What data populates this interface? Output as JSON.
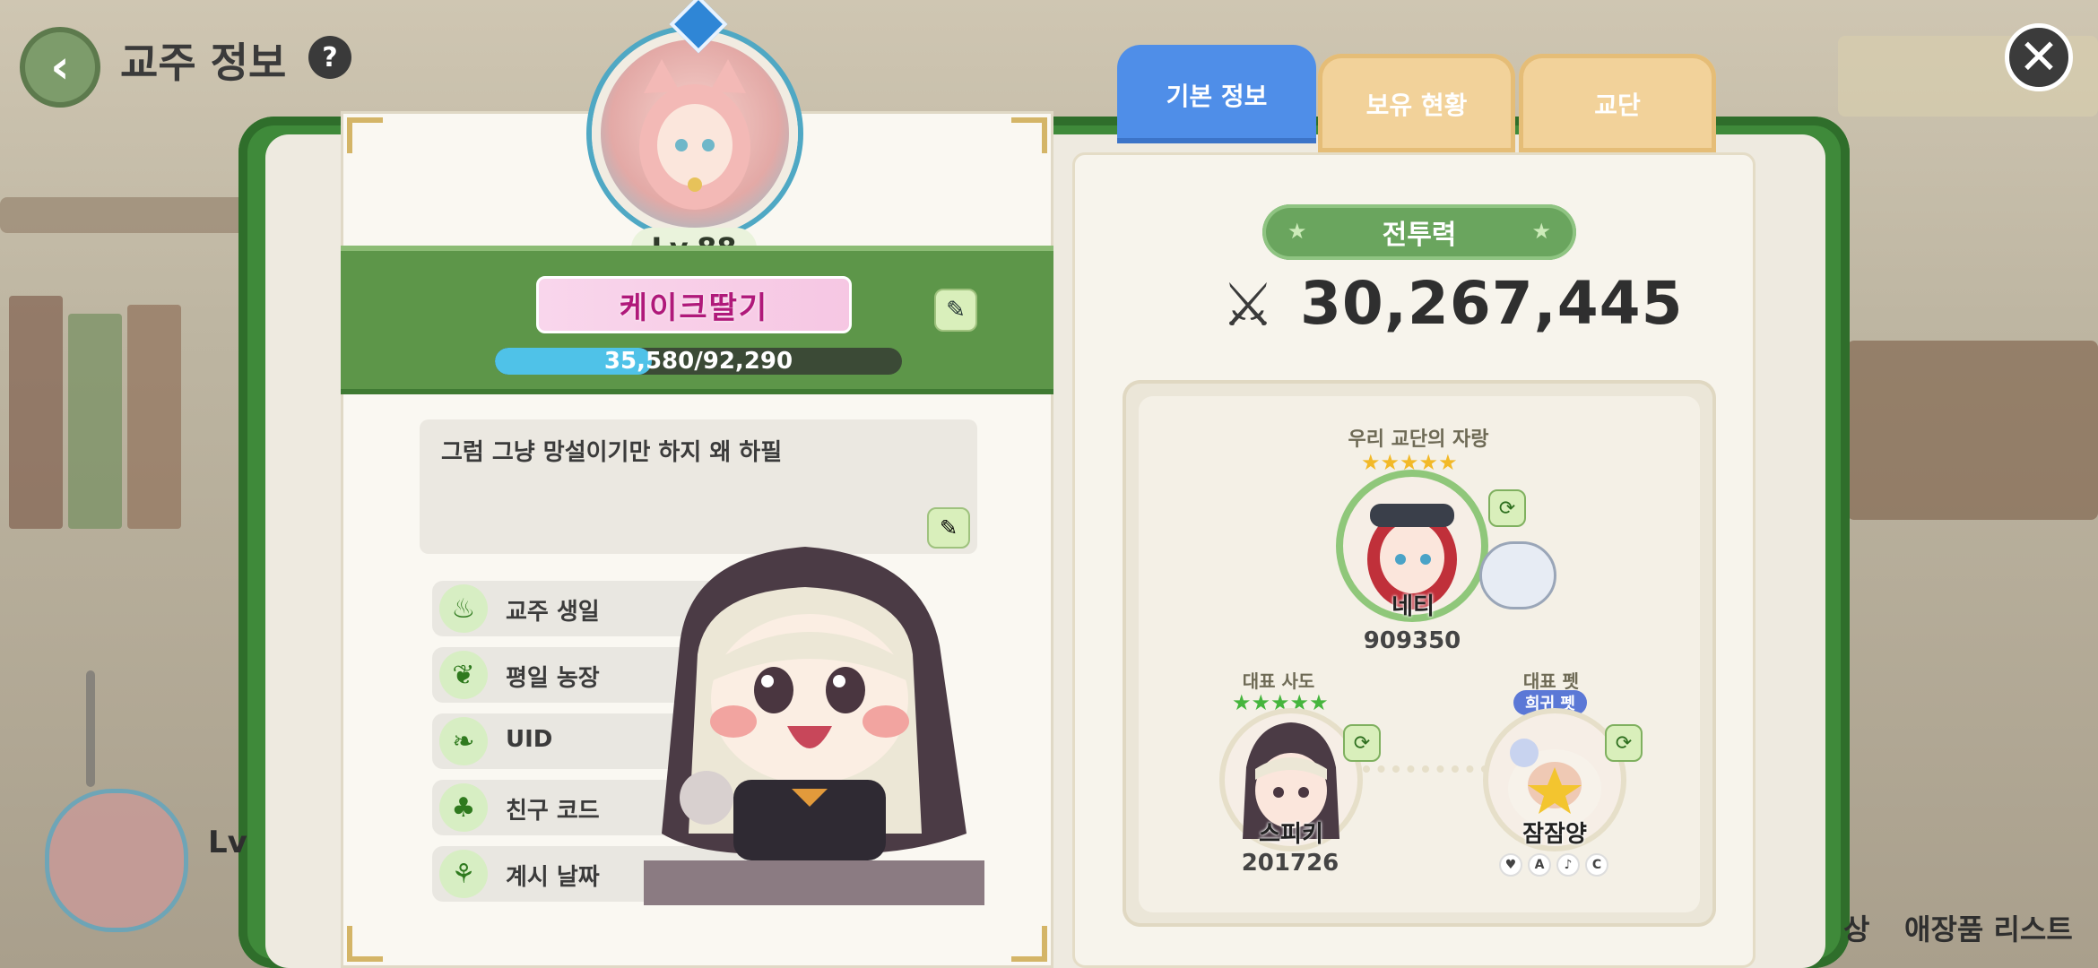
{
  "header": {
    "back_glyph": "‹",
    "title": "교주 정보",
    "help_glyph": "?",
    "close_glyph": "✕"
  },
  "profile": {
    "level": "Lv.88",
    "name": "케이크딸기",
    "exp_text": "35,580/92,290",
    "exp_current": 35580,
    "exp_max": 92290,
    "message": "그럼 그냥 망설이기만 하지 왜 하필",
    "edit_glyph": "✎"
  },
  "info_rows": [
    {
      "label": "교주 생일",
      "icon": "cake-icon",
      "glyph": "♨"
    },
    {
      "label": "평일 농장",
      "icon": "radish-icon",
      "glyph": "❦"
    },
    {
      "label": "UID",
      "icon": "leaf-icon",
      "glyph": "❧"
    },
    {
      "label": "친구 코드",
      "icon": "friends-icon",
      "glyph": "♣"
    },
    {
      "label": "계시 날짜",
      "icon": "sprout-icon",
      "glyph": "⚘"
    }
  ],
  "tabs": [
    {
      "label": "기본 정보",
      "active": true
    },
    {
      "label": "보유 현황",
      "active": false
    },
    {
      "label": "교단",
      "active": false
    }
  ],
  "combat": {
    "title": "전투력",
    "value": "30,267,445",
    "icon_glyph": "⚔",
    "star_glyph": "★"
  },
  "showcase": {
    "title": "우리 교단의 자랑",
    "featured": {
      "name": "네티",
      "score": "909350",
      "stars": "★★★★★"
    },
    "rep_disciple": {
      "label": "대표 사도",
      "name": "스피키",
      "score": "201726",
      "stars": "★★★★★"
    },
    "rep_pet": {
      "label": "대표 펫",
      "tag": "희귀 펫",
      "name": "잠잠양",
      "ranks": [
        "♥",
        "A",
        "♪",
        "C"
      ]
    },
    "refresh_glyph": "⟳"
  },
  "overlay": {
    "lv_fragment": "Lv",
    "bottom_right_1": "상",
    "bottom_right_2": "애장품 리스트"
  },
  "colors": {
    "frame_green": "#3f8a3a",
    "tab_active": "#4f8ee8",
    "tab_inactive": "#f2d29a",
    "exp_fill": "#4fc2e8",
    "name_color": "#b0197a"
  }
}
